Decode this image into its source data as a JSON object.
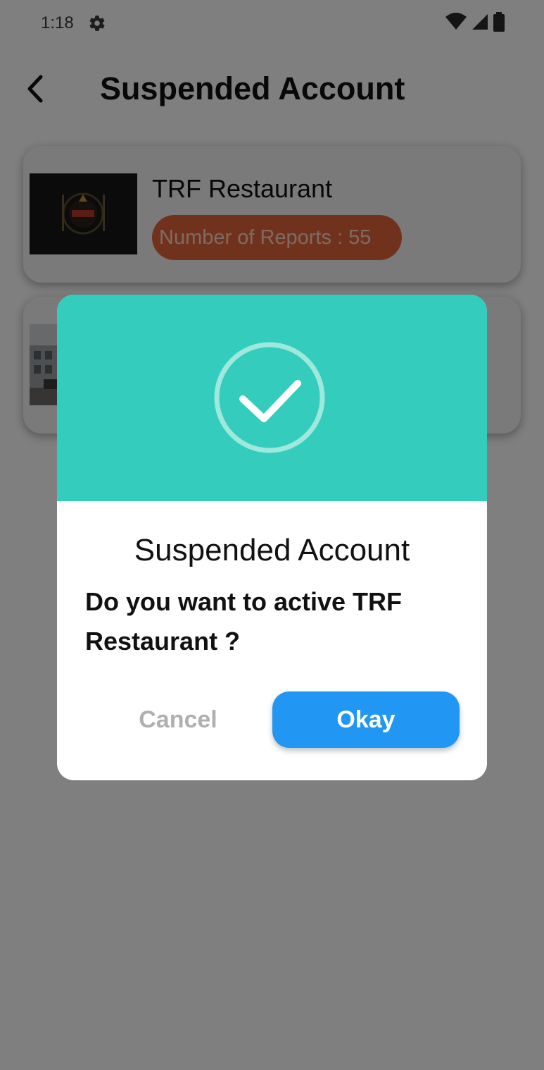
{
  "status_bar": {
    "time": "1:18",
    "icons": [
      "gear-icon",
      "wifi-icon",
      "cell-signal-icon",
      "battery-icon"
    ]
  },
  "header": {
    "title": "Suspended Account",
    "back_icon": "chevron-left-icon"
  },
  "cards": [
    {
      "name": "TRF Restaurant",
      "reports": "Number of Reports : 55"
    }
  ],
  "dialog": {
    "title": "Suspended Account",
    "message": "Do you want to active TRF Restaurant  ?",
    "cancel_label": "Cancel",
    "okay_label": "Okay",
    "icon": "check-circle-icon"
  },
  "colors": {
    "accent_teal": "#34cdbd",
    "okay_blue": "#2196f3",
    "badge_orange": "#e2643a",
    "scrim": "#7b7580"
  }
}
